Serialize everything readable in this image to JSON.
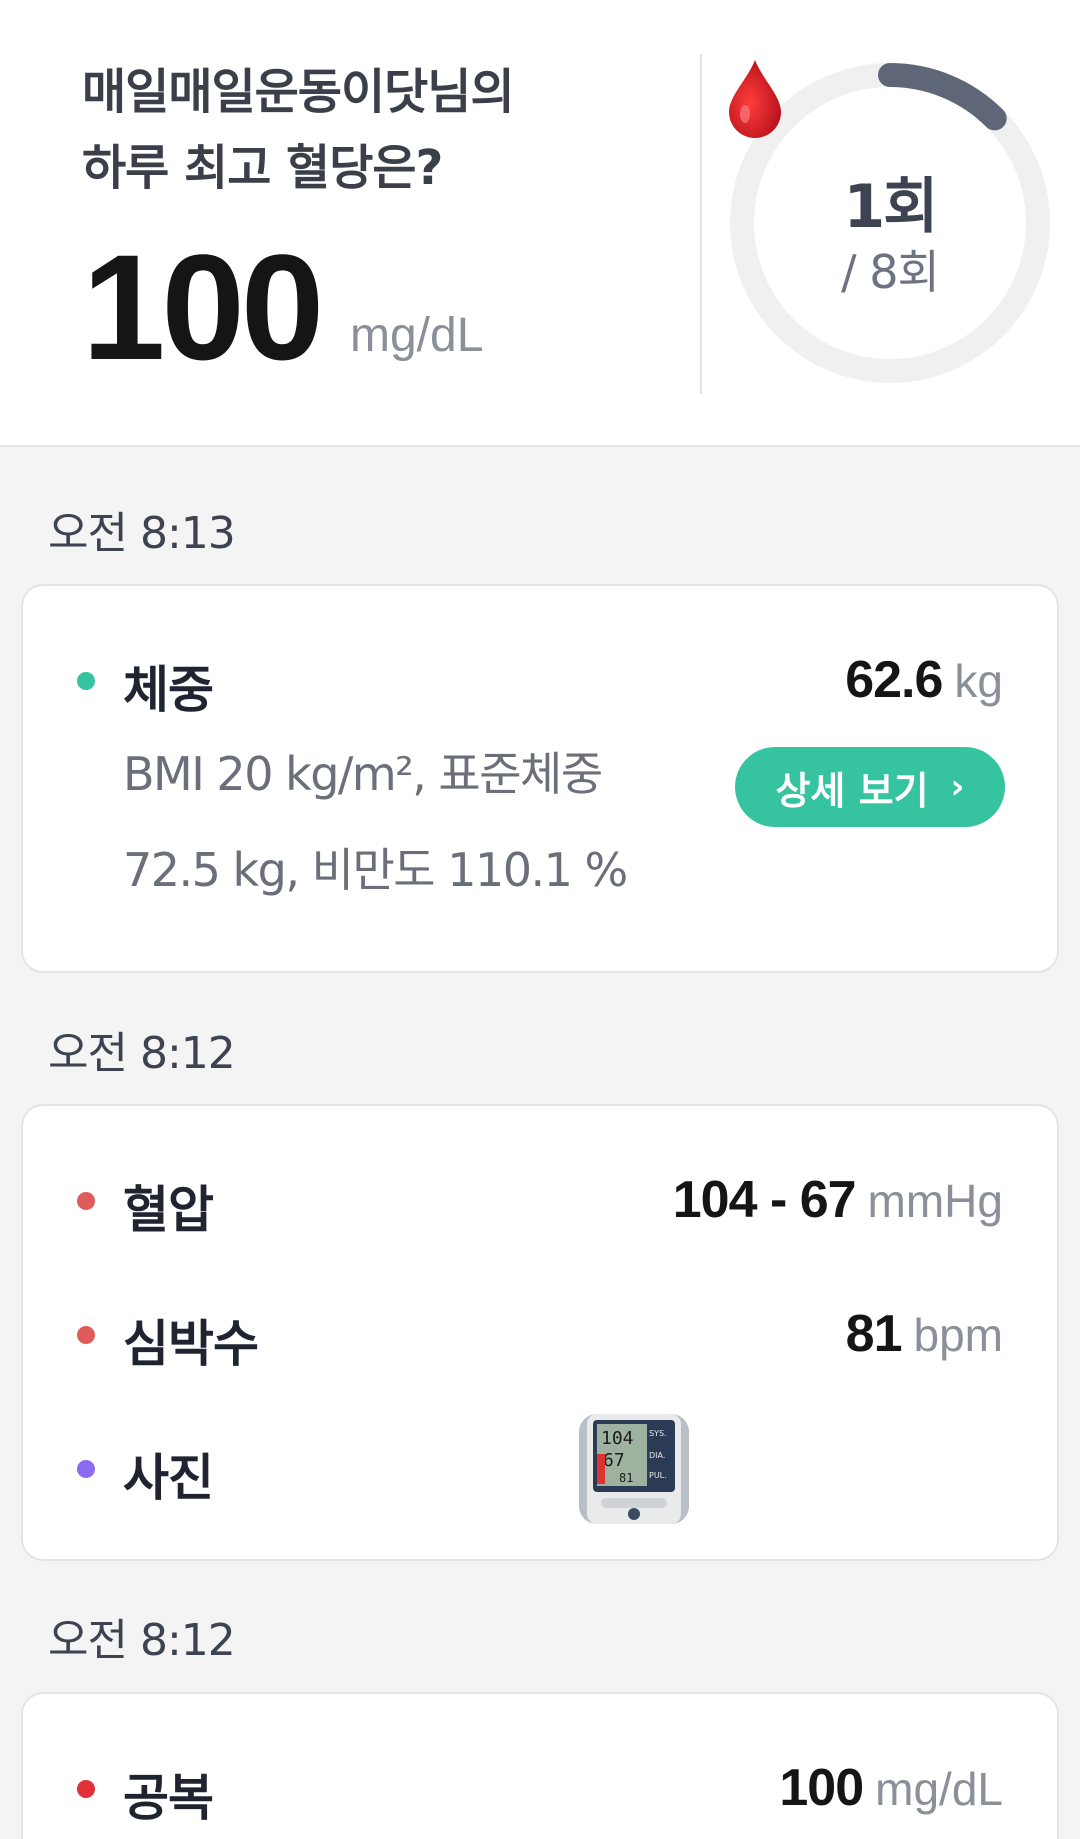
{
  "header": {
    "greeting_line1": "매일매일운동이닷님의",
    "greeting_line2": "하루 최고 혈당은?",
    "max_glucose_value": "100",
    "max_glucose_unit": "mg/dL",
    "ring": {
      "count": "1회",
      "total": "/ 8회",
      "progress_fraction": 0.125
    }
  },
  "entries": [
    {
      "time": "오전 8:13",
      "rows": [
        {
          "label": "체중",
          "value": "62.6",
          "unit": "kg",
          "dot_color": "#35c3a0"
        }
      ],
      "detail_line1": "BMI 20 kg/m², 표준체중",
      "detail_line2": "72.5 kg, 비만도 110.1 %",
      "button_label": "상세 보기",
      "button_chevron": "›"
    },
    {
      "time": "오전 8:12",
      "rows": [
        {
          "label": "혈압",
          "value": "104 - 67",
          "unit": "mmHg",
          "dot_color": "#e05b5b"
        },
        {
          "label": "심박수",
          "value": "81",
          "unit": "bpm",
          "dot_color": "#e05b5b"
        },
        {
          "label": "사진",
          "dot_color": "#8b6cf0"
        }
      ],
      "photo_device_readout": {
        "sys": "104",
        "dia": "67",
        "pul": "81",
        "sys_label": "SYS.",
        "dia_label": "DIA.",
        "pul_label": "PUL."
      }
    },
    {
      "time": "오전 8:12",
      "rows": [
        {
          "label": "공복",
          "value": "100",
          "unit": "mg/dL",
          "dot_color": "#e0303a"
        }
      ]
    }
  ],
  "colors": {
    "accent_green": "#35c3a0",
    "ring_track": "#f0f0f0",
    "ring_progress": "#5f6677",
    "blood_red": "#d81f26"
  }
}
